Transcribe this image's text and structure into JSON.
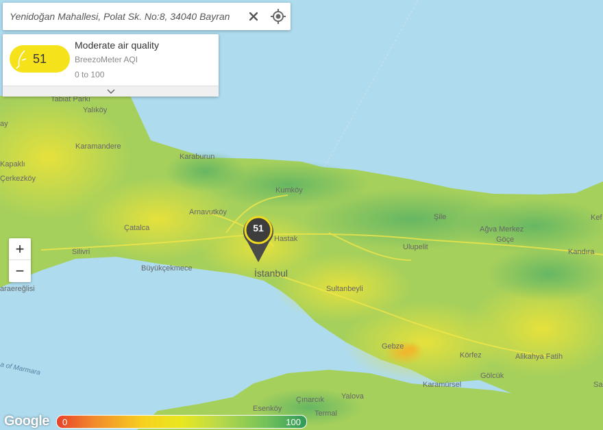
{
  "search": {
    "value": "Yenidoğan Mahallesi, Polat Sk. No:8, 34040 Bayran"
  },
  "icons": {
    "clear": "close-icon",
    "locate": "my-location-icon",
    "expand": "chevron-down-icon"
  },
  "air_quality": {
    "value": "51",
    "title": "Moderate air quality",
    "source": "BreezoMeter AQI",
    "range": "0 to 100",
    "badge_color": "#f5e21a"
  },
  "zoom": {
    "in_label": "+",
    "out_label": "−"
  },
  "marker": {
    "value": "51"
  },
  "legend": {
    "min": "0",
    "max": "100"
  },
  "branding": {
    "google": "Google"
  },
  "map_labels": {
    "top_park": "Tabiat Parkı",
    "yalikoy": "Yalıköy",
    "karamandere": "Karamandere",
    "kapakli": "Kapaklı",
    "cerkezkoy": "Çerkezköy",
    "karaburun": "Karaburun",
    "kumkoy": "Kumköy",
    "arnavutkoy": "Arnavutköy",
    "catalca": "Çatalca",
    "silivri": "Silivri",
    "buyukcekmece": "Büyükçekmece",
    "istanbul": "İstanbul",
    "hastak": "Hastak",
    "sile": "Şile",
    "agva": "Ağva Merkez",
    "goce": "Göçe",
    "kefken": "Kef",
    "kandira": "Kandıra",
    "ulupelit": "Ulupelit",
    "sultanbeyli": "Sultanbeyli",
    "gebze": "Gebze",
    "korfez": "Körfez",
    "alikahya": "Alikahya Fatih",
    "golcuk": "Gölcük",
    "karamursel": "Karamürsel",
    "yalova": "Yalova",
    "cinarcik": "Çınarcık",
    "esenkoy": "Esenköy",
    "termal": "Termal",
    "marmaraereglisi": "araereğlisi",
    "sea_of_marmara": "a of Marmara",
    "edge_left": "ay",
    "edge_right": "Sa"
  }
}
